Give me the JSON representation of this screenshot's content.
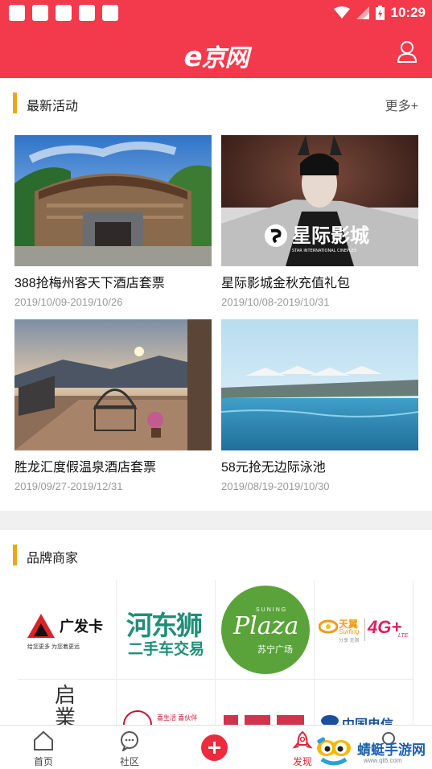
{
  "status_bar": {
    "time": "10:29"
  },
  "header": {
    "logo_e": "e",
    "logo_text": "京网"
  },
  "activities": {
    "title": "最新活动",
    "more": "更多+",
    "items": [
      {
        "title": "388抢梅州客天下酒店套票",
        "date": "2019/10/09-2019/10/26"
      },
      {
        "title": "星际影城金秋充值礼包",
        "date": "2019/10/08-2019/10/31",
        "image_text": "星际影城",
        "image_subtext": "STAR INTERNATIONAL CINEPLEX"
      },
      {
        "title": "胜龙汇度假温泉酒店套票",
        "date": "2019/09/27-2019/12/31"
      },
      {
        "title": "58元抢无边际泳池",
        "date": "2019/08/19-2019/10/30"
      }
    ]
  },
  "brands": {
    "title": "品牌商家",
    "items": [
      {
        "name": "广发卡",
        "sub": "给您更多  为您着更远"
      },
      {
        "name": "河东狮",
        "sub": "二手车交易"
      },
      {
        "name": "Plaza",
        "sub": "苏宁广场",
        "top": "SUNING"
      },
      {
        "name": "天翼",
        "sub": "4G+",
        "tagline": "Surfing",
        "lte": "LTE",
        "slogan": "分享 无限"
      },
      {
        "name": "启業",
        "sub": ""
      },
      {
        "name": "喜生活 喜伙伴",
        "sub": ""
      },
      {
        "name": "",
        "sub": ""
      },
      {
        "name": "中国电信",
        "sub": ""
      }
    ]
  },
  "tabbar": {
    "home": "首页",
    "community": "社区",
    "discover": "发现"
  },
  "watermark": {
    "text": "蜻蜓手游网",
    "url": "www.qt6.com"
  }
}
